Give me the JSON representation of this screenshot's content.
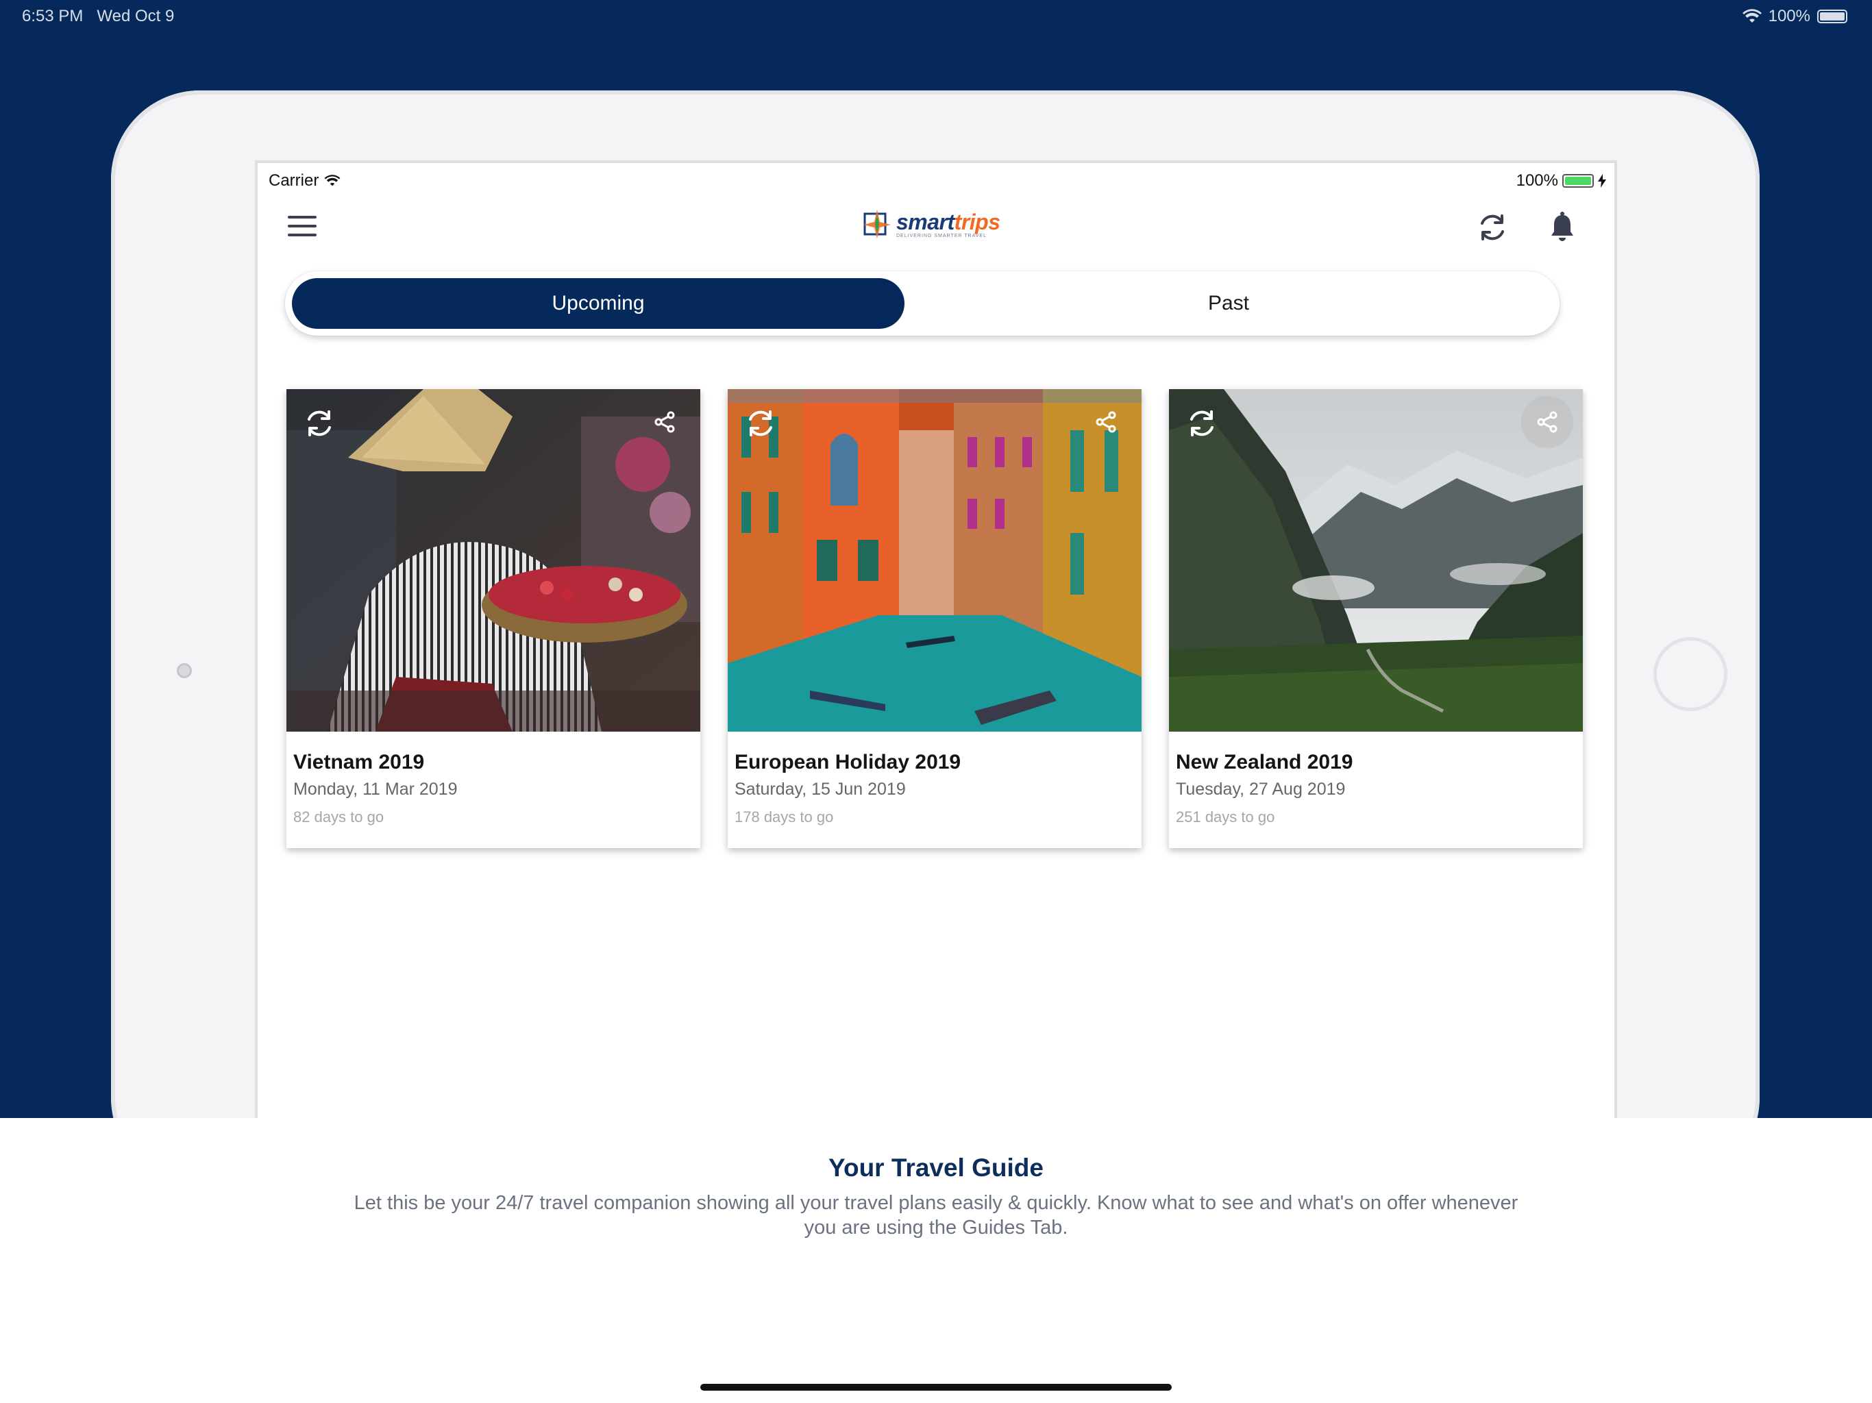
{
  "system_status": {
    "time": "6:53 PM",
    "date": "Wed Oct 9",
    "battery": "100%"
  },
  "app_status": {
    "carrier": "Carrier",
    "battery": "100%"
  },
  "header": {
    "logo_text_a": "smart",
    "logo_text_b": "trips",
    "logo_tagline": "DELIVERING SMARTER TRAVEL"
  },
  "tabs": [
    {
      "label": "Upcoming",
      "active": true
    },
    {
      "label": "Past",
      "active": false
    }
  ],
  "trips": [
    {
      "title": "Vietnam 2019",
      "date": "Monday, 11 Mar 2019",
      "countdown": "82 days to go"
    },
    {
      "title": "European Holiday 2019",
      "date": "Saturday, 15 Jun 2019",
      "countdown": "178 days to go"
    },
    {
      "title": "New Zealand 2019",
      "date": "Tuesday, 27 Aug 2019",
      "countdown": "251 days to go"
    }
  ],
  "guide": {
    "title": "Your Travel Guide",
    "description": "Let this be your 24/7 travel companion showing all your travel plans easily & quickly. Know what to see and what's on offer whenever you are using the Guides Tab."
  },
  "colors": {
    "brand_navy": "#05295a",
    "brand_orange": "#f26a21",
    "battery_green": "#4cd964"
  }
}
